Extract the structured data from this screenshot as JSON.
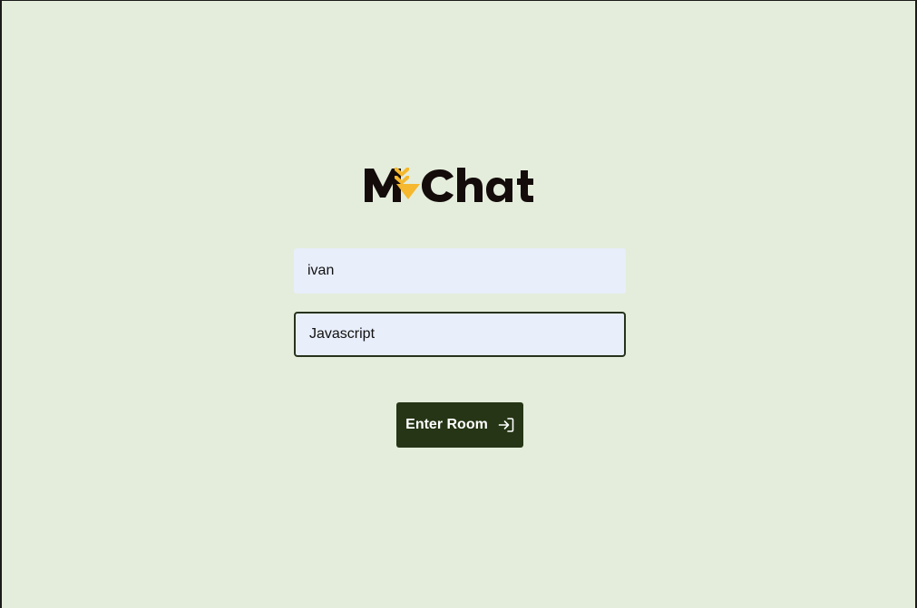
{
  "app": {
    "logo_text": "MyChat"
  },
  "form": {
    "username_value": "ivan",
    "room_value": "Javascript",
    "submit_label": "Enter Room"
  },
  "colors": {
    "background": "#e4eddb",
    "logo_dark": "#140b0b",
    "logo_accent": "#f5b82e",
    "button": "#253515",
    "input_bg": "#e8eefa"
  },
  "icons": {
    "submit_icon": "sign-in-icon"
  }
}
